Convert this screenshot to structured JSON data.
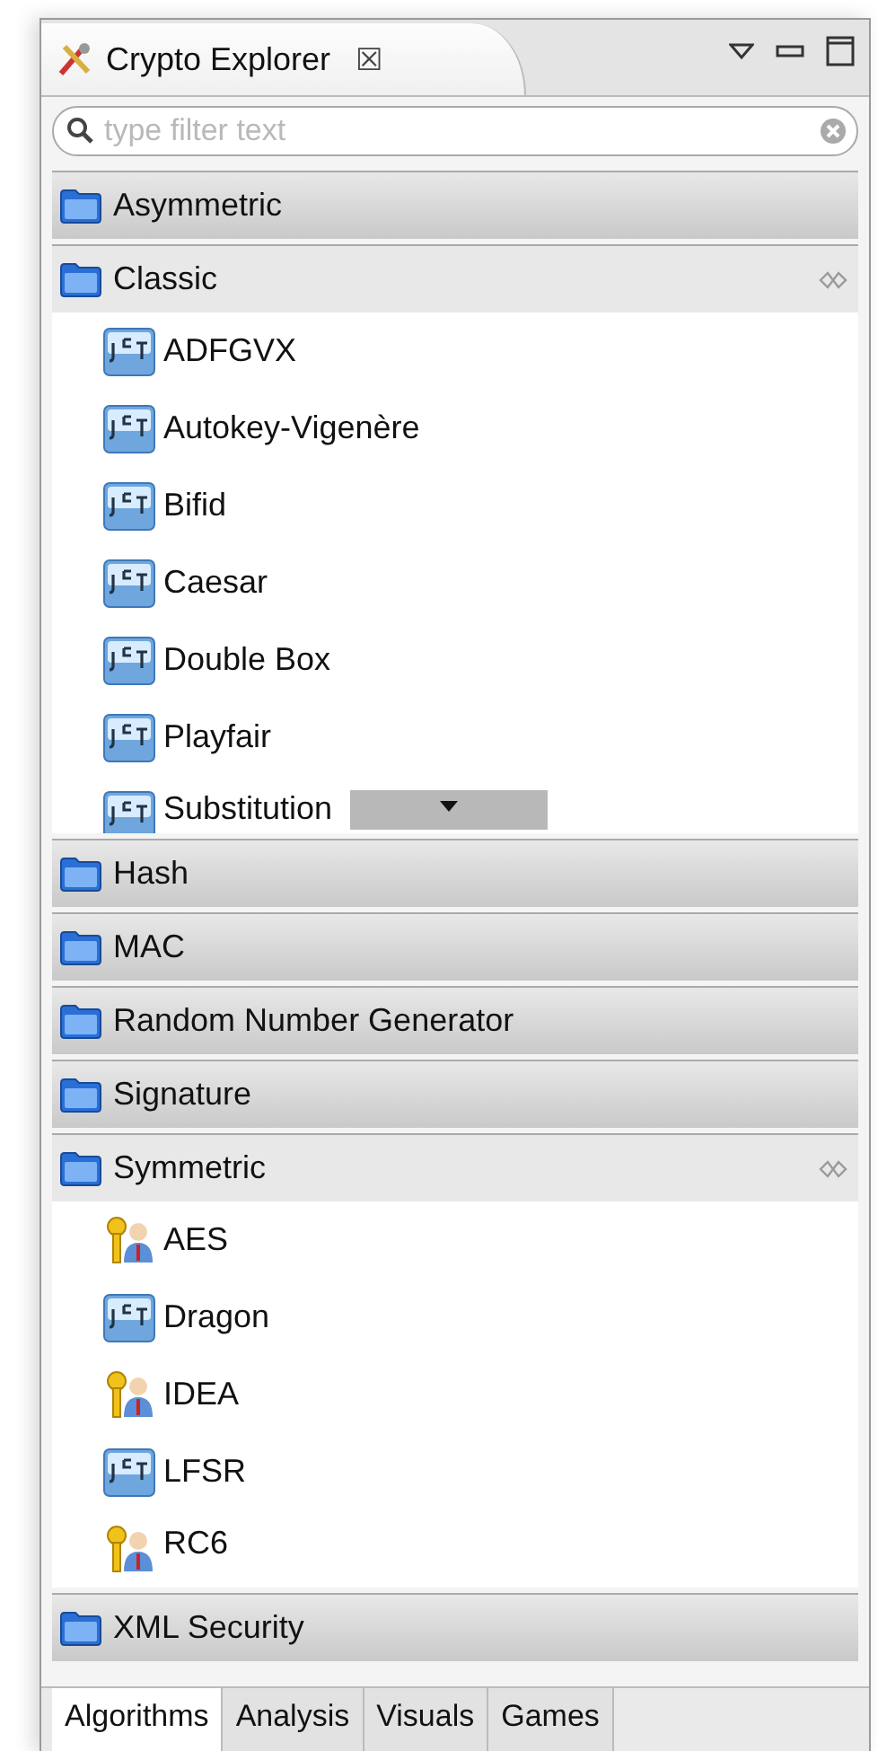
{
  "view": {
    "title": "Crypto Explorer",
    "close": "☒"
  },
  "filter": {
    "placeholder": "type filter text"
  },
  "sections": [
    {
      "label": "Asymmetric",
      "expanded": false
    },
    {
      "label": "Classic",
      "expanded": true,
      "items": [
        {
          "label": "ADFGVX",
          "kind": "jct"
        },
        {
          "label": "Autokey-Vigenère",
          "kind": "jct"
        },
        {
          "label": "Bifid",
          "kind": "jct"
        },
        {
          "label": "Caesar",
          "kind": "jct"
        },
        {
          "label": "Double Box",
          "kind": "jct"
        },
        {
          "label": "Playfair",
          "kind": "jct"
        },
        {
          "label": "Substitution",
          "kind": "jct"
        }
      ]
    },
    {
      "label": "Hash",
      "expanded": false
    },
    {
      "label": "MAC",
      "expanded": false
    },
    {
      "label": "Random Number Generator",
      "expanded": false
    },
    {
      "label": "Signature",
      "expanded": false
    },
    {
      "label": "Symmetric",
      "expanded": true,
      "items": [
        {
          "label": "AES",
          "kind": "keys"
        },
        {
          "label": "Dragon",
          "kind": "jct"
        },
        {
          "label": "IDEA",
          "kind": "keys"
        },
        {
          "label": "LFSR",
          "kind": "jct"
        },
        {
          "label": "RC6",
          "kind": "keys"
        }
      ]
    },
    {
      "label": "XML Security",
      "expanded": false
    }
  ],
  "tabs": [
    {
      "label": "Algorithms",
      "selected": true
    },
    {
      "label": "Analysis",
      "selected": false
    },
    {
      "label": "Visuals",
      "selected": false
    },
    {
      "label": "Games",
      "selected": false
    }
  ]
}
